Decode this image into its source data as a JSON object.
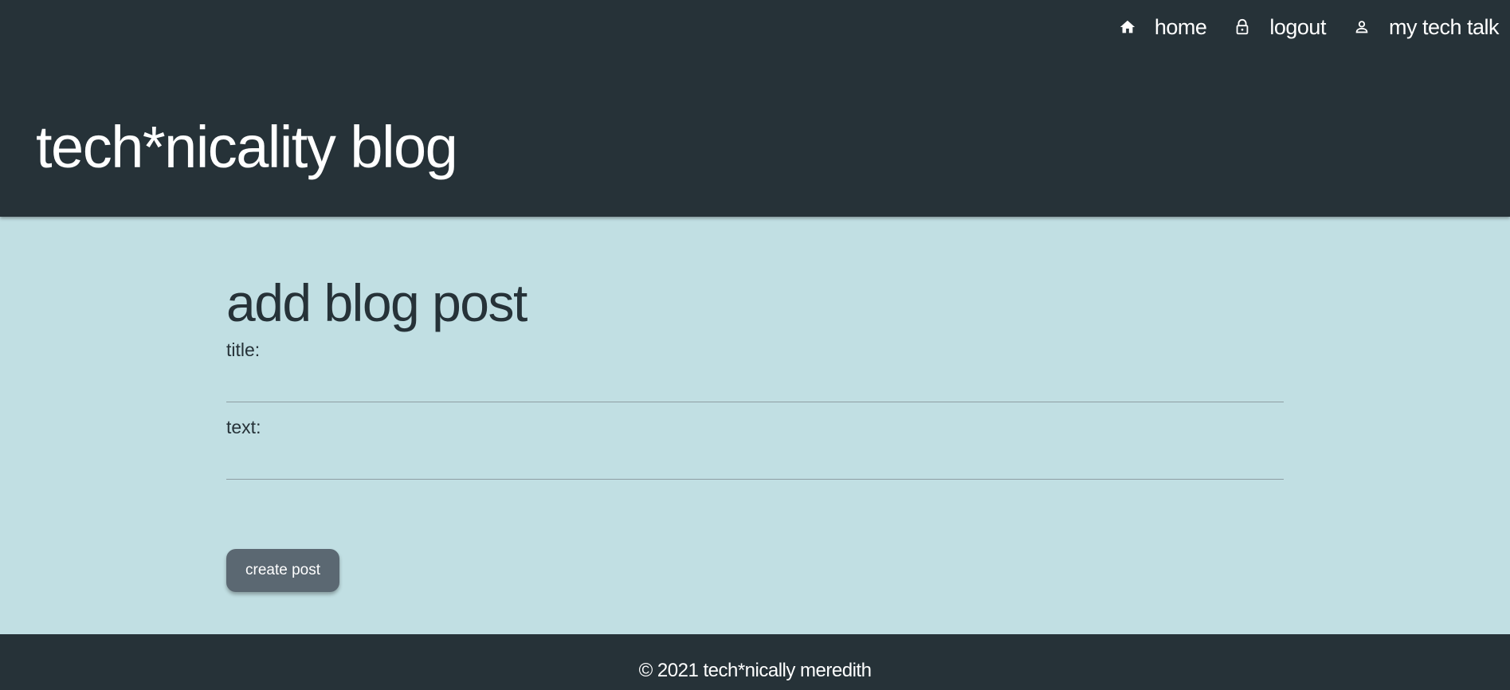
{
  "nav": {
    "items": [
      {
        "label": "home",
        "icon": "home-icon"
      },
      {
        "label": "logout",
        "icon": "lock-icon"
      },
      {
        "label": "my tech talk",
        "icon": "user-icon"
      }
    ]
  },
  "header": {
    "brand": "tech*nicality blog"
  },
  "main": {
    "page_title": "add blog post",
    "title_label": "title:",
    "title_value": "",
    "text_label": "text:",
    "text_value": "",
    "submit_label": "create post"
  },
  "footer": {
    "text": "© 2021 tech*nically meredith"
  },
  "colors": {
    "header_bg": "#263238",
    "page_bg": "#c1dfe3",
    "button_bg": "#5b6872"
  }
}
